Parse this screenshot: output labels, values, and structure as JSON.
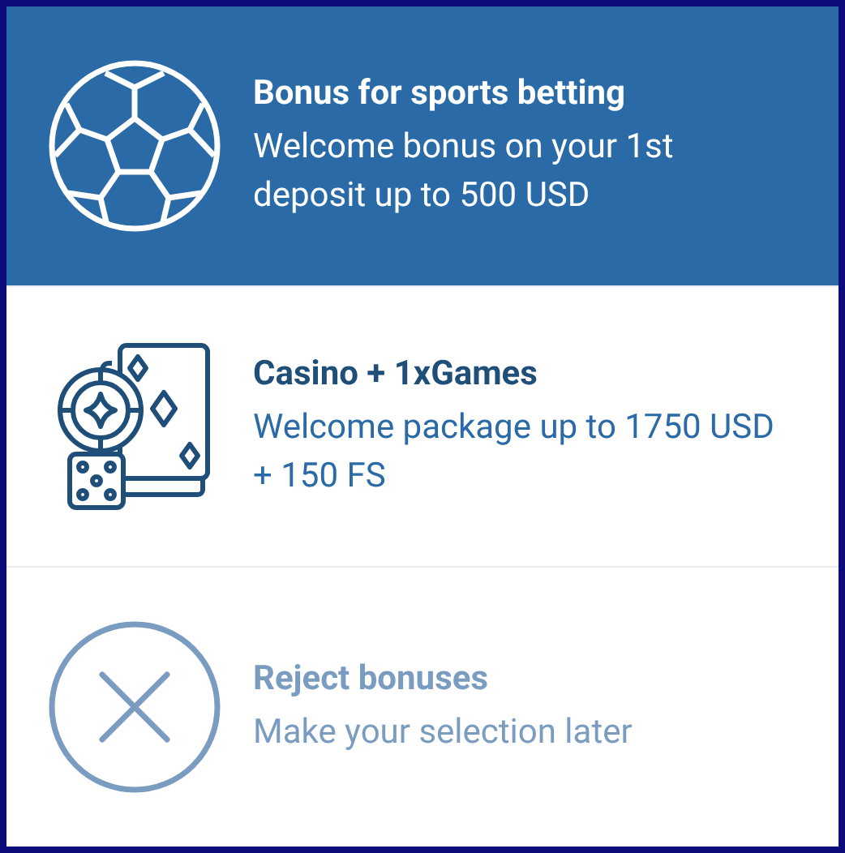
{
  "options": [
    {
      "kind": "sports",
      "selected": true,
      "title": "Bonus for sports betting",
      "description": "Welcome bonus on your 1st deposit up to 500 USD"
    },
    {
      "kind": "casino",
      "selected": false,
      "title": "Casino + 1xGames",
      "description": "Welcome package up to 1750 USD + 150 FS"
    },
    {
      "kind": "reject",
      "selected": false,
      "title": "Reject bonuses",
      "description": "Make your selection later"
    }
  ]
}
